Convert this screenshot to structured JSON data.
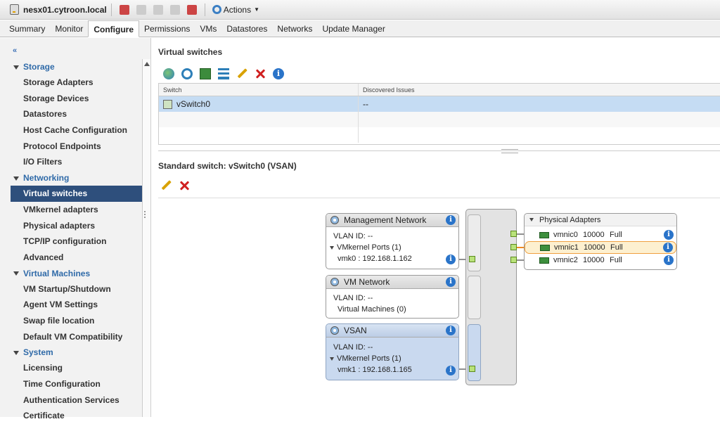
{
  "header": {
    "host": "nesx01.cytroon.local",
    "actions": "Actions"
  },
  "tabs": [
    "Summary",
    "Monitor",
    "Configure",
    "Permissions",
    "VMs",
    "Datastores",
    "Networks",
    "Update Manager"
  ],
  "nav": {
    "collapse": "«",
    "sections": [
      {
        "title": "Storage",
        "items": [
          "Storage Adapters",
          "Storage Devices",
          "Datastores",
          "Host Cache Configuration",
          "Protocol Endpoints",
          "I/O Filters"
        ]
      },
      {
        "title": "Networking",
        "items": [
          "Virtual switches",
          "VMkernel adapters",
          "Physical adapters",
          "TCP/IP configuration",
          "Advanced"
        ]
      },
      {
        "title": "Virtual Machines",
        "items": [
          "VM Startup/Shutdown",
          "Agent VM Settings",
          "Swap file location",
          "Default VM Compatibility"
        ]
      },
      {
        "title": "System",
        "items": [
          "Licensing",
          "Time Configuration",
          "Authentication Services",
          "Certificate"
        ]
      }
    ],
    "selected": "Virtual switches"
  },
  "vswitches": {
    "title": "Virtual switches",
    "columns": [
      "Switch",
      "Discovered Issues"
    ],
    "rows": [
      {
        "switch": "vSwitch0",
        "issues": "--"
      }
    ]
  },
  "standard": {
    "title": "Standard switch: vSwitch0 (VSAN)",
    "portgroups": [
      {
        "name": "Management Network",
        "vlan": "VLAN ID: --",
        "ports_label": "VMkernel Ports (1)",
        "port": "vmk0 : 192.168.1.162"
      },
      {
        "name": "VM Network",
        "vlan": "VLAN ID: --",
        "vms_label": "Virtual Machines (0)"
      },
      {
        "name": "VSAN",
        "vlan": "VLAN ID: --",
        "ports_label": "VMkernel Ports (1)",
        "port": "vmk1 : 192.168.1.165"
      }
    ],
    "physical": {
      "title": "Physical Adapters",
      "adapters": [
        {
          "name": "vmnic0",
          "speed": "10000",
          "duplex": "Full"
        },
        {
          "name": "vmnic1",
          "speed": "10000",
          "duplex": "Full"
        },
        {
          "name": "vmnic2",
          "speed": "10000",
          "duplex": "Full"
        }
      ]
    }
  },
  "info_glyph": "i",
  "colors": {
    "accent": "#2e4f7c",
    "link": "#2f6aa8",
    "highlight": "#f0a040",
    "port": "#b9e27a"
  }
}
